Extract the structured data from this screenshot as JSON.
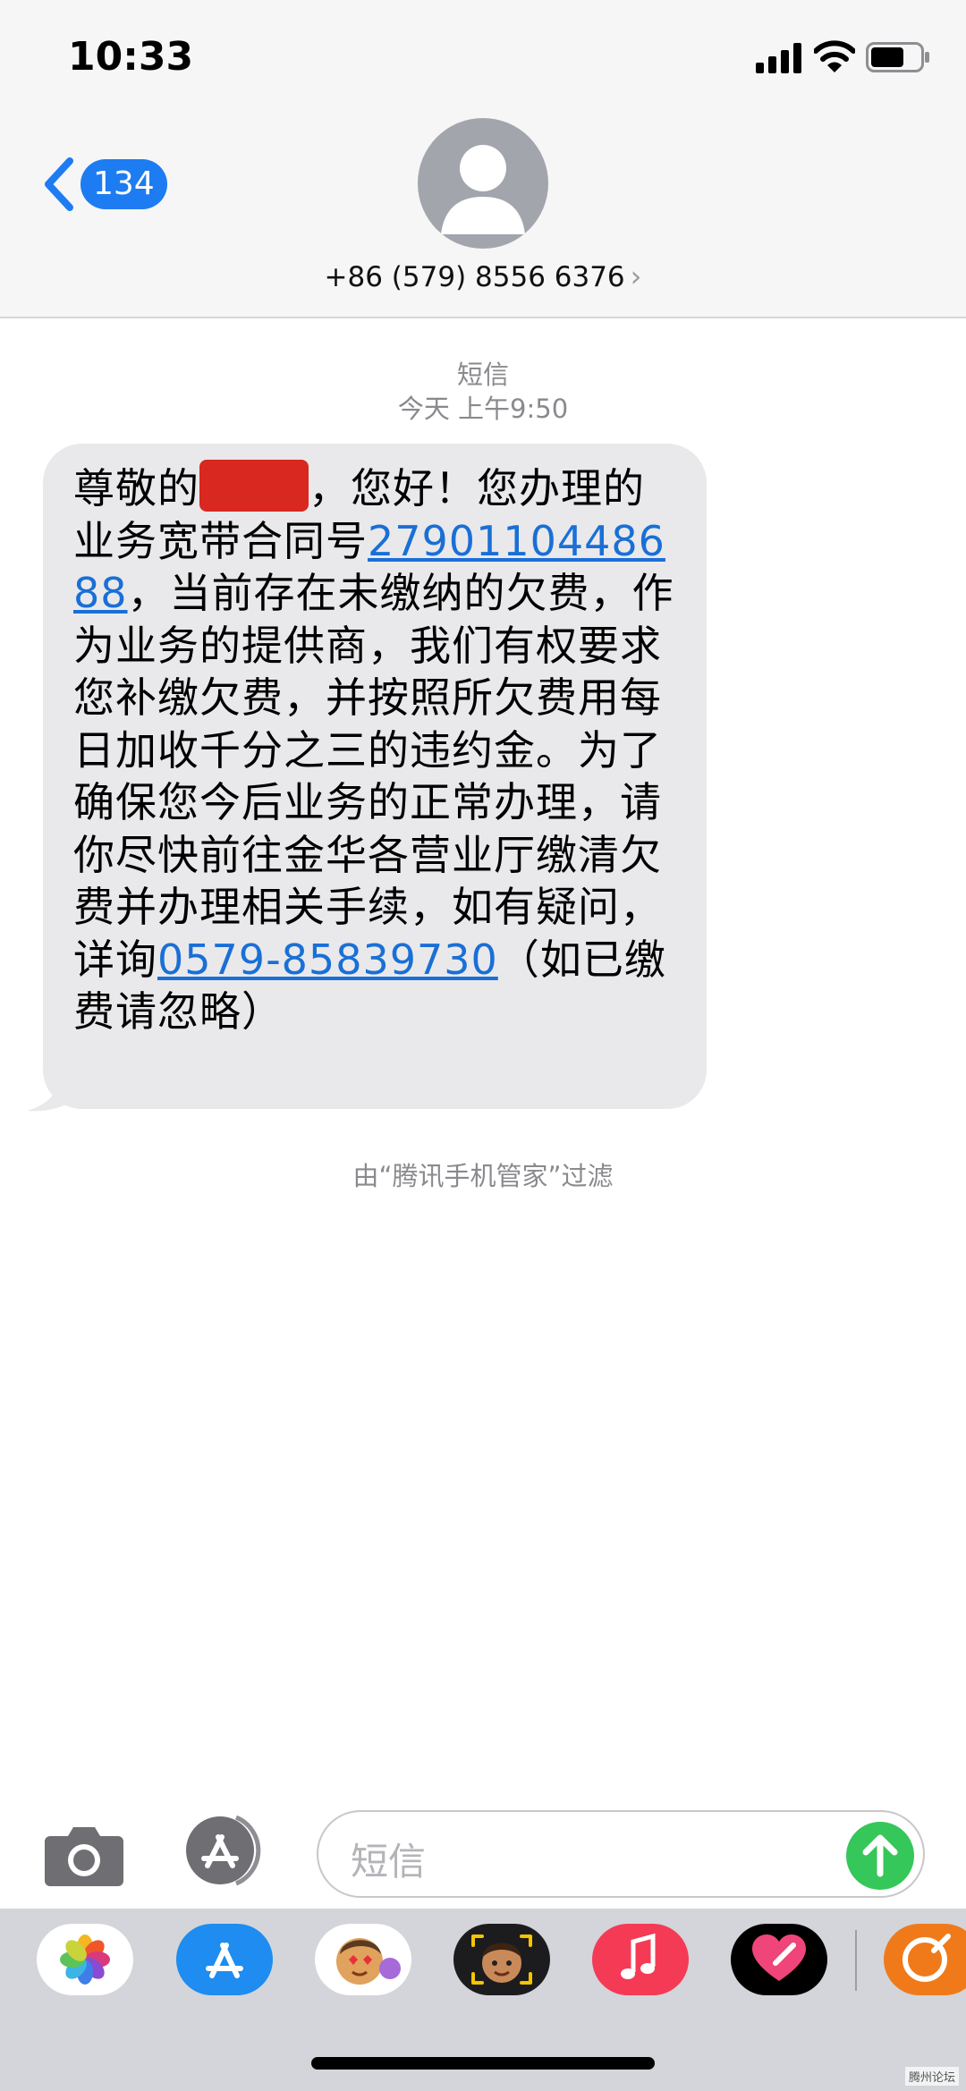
{
  "status_bar": {
    "time": "10:33"
  },
  "header": {
    "back_badge": "134",
    "contact": "+86 (579) 8556 6376",
    "contact_chevron": "›"
  },
  "thread": {
    "label": "短信",
    "timestamp": "今天 上午9:50",
    "message": {
      "part1": "尊敬的",
      "part2": "，您好！您办理的业务宽带合同号",
      "contract_number": "2790110448688",
      "part3": "，当前存在未缴纳的欠费，作为业务的提供商，我们有权要求您补缴欠费，并按照所欠费用每日加收千分之三的违约金。为了确保您今后业务的正常办理，请你尽快前往金华各营业厅缴清欠费并办理相关手续，如有疑问，详询",
      "phone_number": "0579-85839730",
      "part4": "（如已缴费请忽略）"
    },
    "filter_note": "由“腾讯手机管家”过滤"
  },
  "compose": {
    "placeholder": "短信"
  },
  "app_drawer": {
    "apps": [
      "photos-icon",
      "app-store-icon",
      "memoji-stickers-icon",
      "memoji-icon",
      "music-icon",
      "digital-touch-icon",
      "third-party-app-icon"
    ]
  },
  "colors": {
    "accent": "#1d7cf2",
    "bubble": "#e9e9eb",
    "send": "#35c759",
    "link": "#1a6fd6"
  },
  "watermark": "腾州论坛"
}
